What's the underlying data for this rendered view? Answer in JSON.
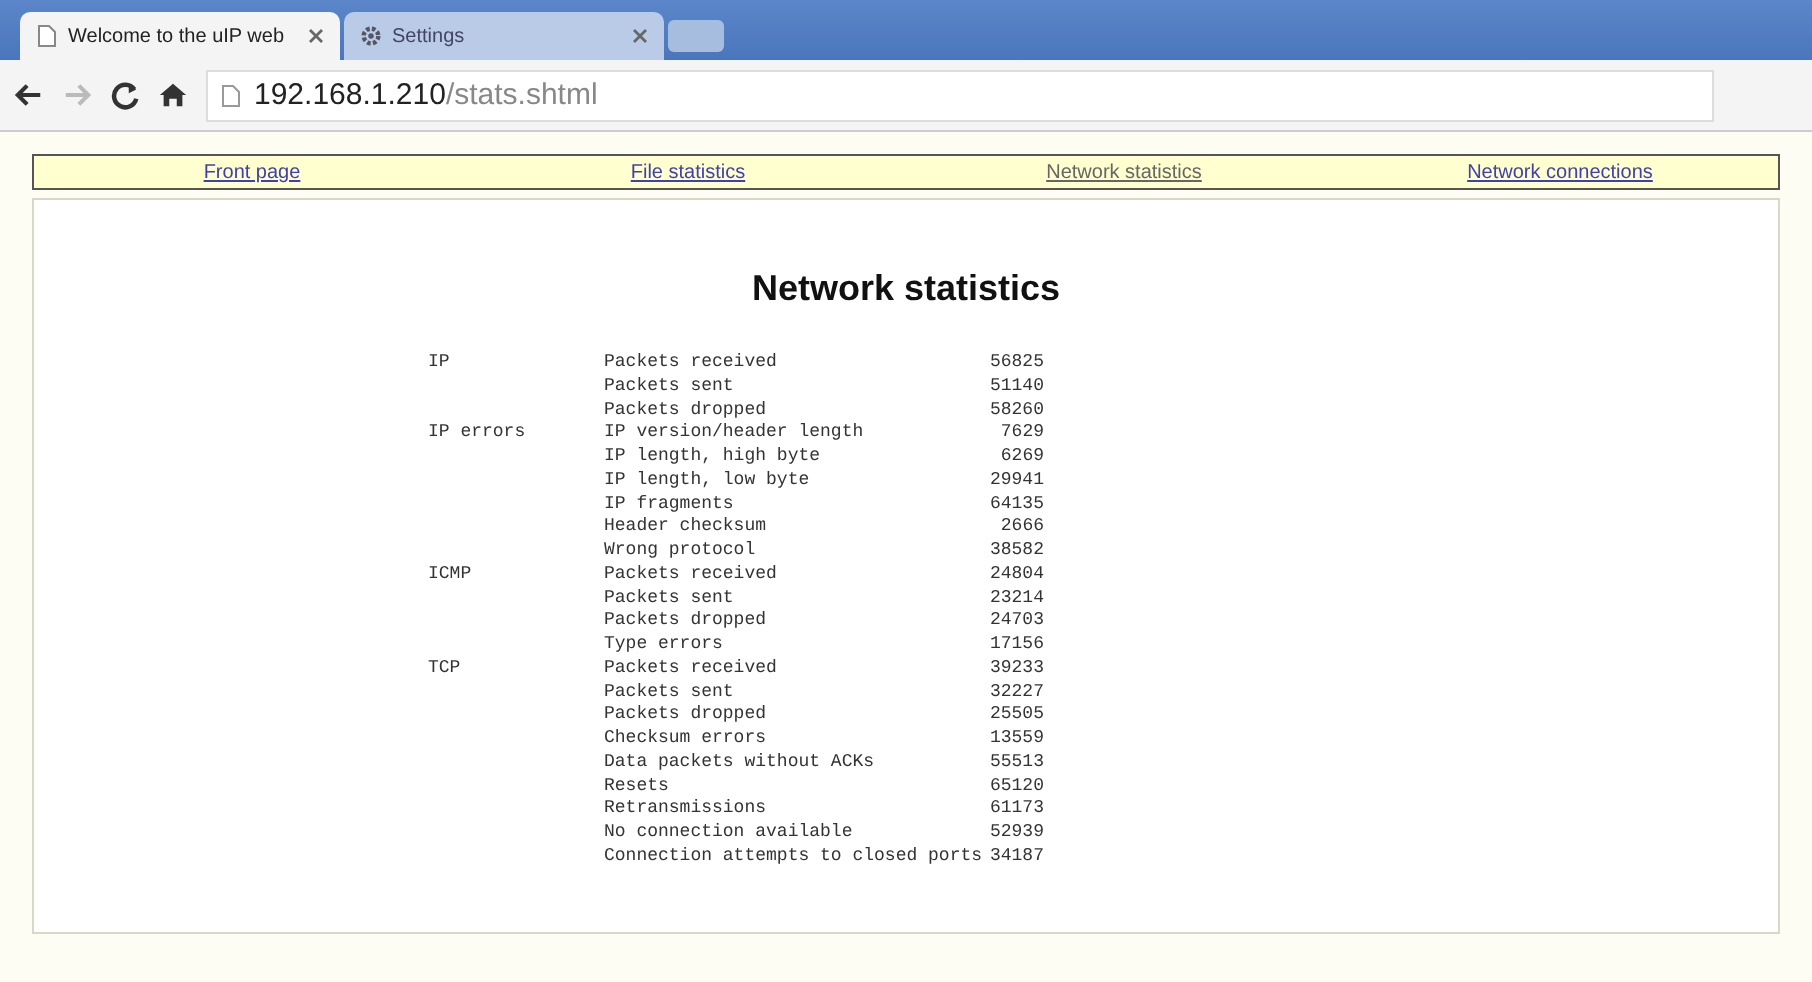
{
  "tabs": [
    {
      "title": "Welcome to the uIP web",
      "selected": true,
      "kind": "page"
    },
    {
      "title": "Settings",
      "selected": false,
      "kind": "settings"
    }
  ],
  "address": {
    "host": "192.168.1.210",
    "path": "/stats.shtml"
  },
  "nav": [
    {
      "label": "Front page",
      "selected": false
    },
    {
      "label": "File statistics",
      "selected": false
    },
    {
      "label": "Network statistics",
      "selected": true
    },
    {
      "label": "Network connections",
      "selected": false
    }
  ],
  "heading": "Network statistics",
  "groups": [
    {
      "name": "IP",
      "rows": [
        {
          "label": "Packets received",
          "value": "56825"
        },
        {
          "label": "Packets sent",
          "value": "51140"
        },
        {
          "label": "Packets dropped",
          "value": "58260"
        }
      ]
    },
    {
      "name": "IP errors",
      "rows": [
        {
          "label": "IP version/header length",
          "value": "7629"
        },
        {
          "label": "IP length, high byte",
          "value": "6269"
        },
        {
          "label": "IP length, low byte",
          "value": "29941"
        },
        {
          "label": "IP fragments",
          "value": "64135"
        },
        {
          "label": "Header checksum",
          "value": "2666"
        },
        {
          "label": "Wrong protocol",
          "value": "38582"
        }
      ]
    },
    {
      "name": "ICMP",
      "rows": [
        {
          "label": "Packets received",
          "value": "24804"
        },
        {
          "label": "Packets sent",
          "value": "23214"
        },
        {
          "label": "Packets dropped",
          "value": "24703"
        },
        {
          "label": "Type errors",
          "value": "17156"
        }
      ]
    },
    {
      "name": "TCP",
      "rows": [
        {
          "label": "Packets received",
          "value": "39233"
        },
        {
          "label": "Packets sent",
          "value": "32227"
        },
        {
          "label": "Packets dropped",
          "value": "25505"
        },
        {
          "label": "Checksum errors",
          "value": "13559"
        },
        {
          "label": "Data packets without ACKs",
          "value": "55513"
        },
        {
          "label": "Resets",
          "value": "65120"
        },
        {
          "label": "Retransmissions",
          "value": "61173"
        },
        {
          "label": "No connection available",
          "value": "52939"
        },
        {
          "label": "Connection attempts to closed ports",
          "value": "34187"
        }
      ]
    }
  ]
}
